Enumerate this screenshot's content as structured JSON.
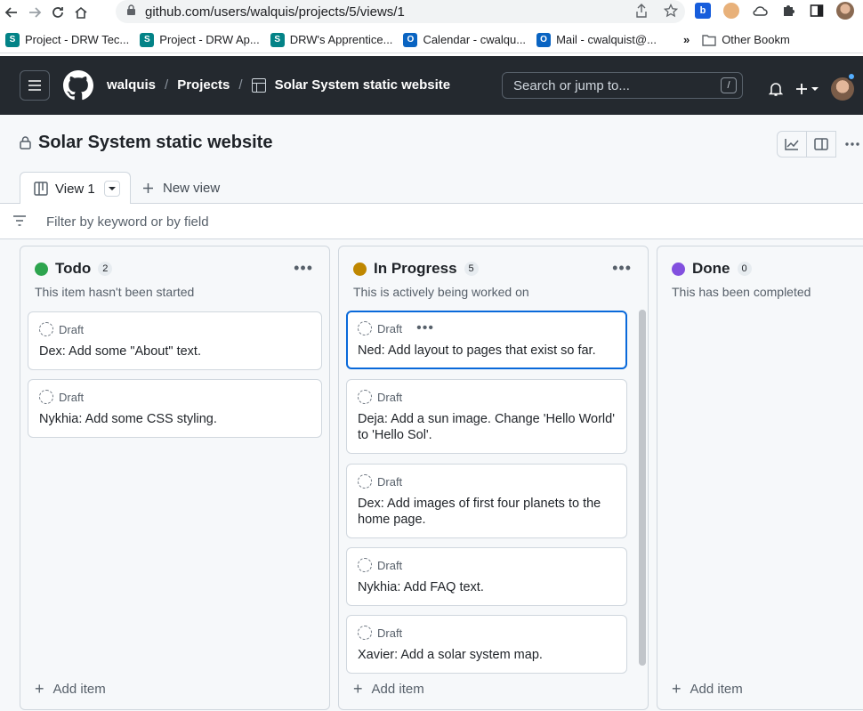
{
  "browser": {
    "url": "github.com/users/walquis/projects/5/views/1",
    "bookmarks": [
      {
        "label": "Project - DRW Tec...",
        "icon": "sharepoint-icon"
      },
      {
        "label": "Project - DRW Ap...",
        "icon": "sharepoint-icon"
      },
      {
        "label": "DRW's Apprentice...",
        "icon": "sharepoint-icon"
      },
      {
        "label": "Calendar - cwalqu...",
        "icon": "outlook-icon"
      },
      {
        "label": "Mail - cwalquist@...",
        "icon": "outlook-icon"
      }
    ],
    "more_bookmarks": "»",
    "other_bookmarks": "Other Bookm"
  },
  "header": {
    "user": "walquis",
    "projects": "Projects",
    "project_name": "Solar System static website",
    "search_placeholder": "Search or jump to...",
    "search_shortcut": "/"
  },
  "page": {
    "title": "Solar System static website"
  },
  "tabs": {
    "active": "View 1",
    "new_view": "New view"
  },
  "filter": {
    "placeholder": "Filter by keyword or by field"
  },
  "columns": [
    {
      "name": "Todo",
      "count": "2",
      "color": "#2da44e",
      "description": "This item hasn't been started",
      "cards": [
        {
          "draft": "Draft",
          "title": "Dex: Add some \"About\" text."
        },
        {
          "draft": "Draft",
          "title": "Nykhia: Add some CSS styling."
        }
      ],
      "add_item": "Add item"
    },
    {
      "name": "In Progress",
      "count": "5",
      "color": "#bf8700",
      "description": "This is actively being worked on",
      "cards": [
        {
          "draft": "Draft",
          "title": "Ned: Add layout to pages that exist so far."
        },
        {
          "draft": "Draft",
          "title": "Deja: Add a sun image. Change 'Hello World' to 'Hello Sol'."
        },
        {
          "draft": "Draft",
          "title": "Dex: Add images of first four planets to the home page."
        },
        {
          "draft": "Draft",
          "title": "Nykhia: Add FAQ text."
        },
        {
          "draft": "Draft",
          "title": "Xavier: Add a solar system map."
        }
      ],
      "add_item": "Add item"
    },
    {
      "name": "Done",
      "count": "0",
      "color": "#8250df",
      "description": "This has been completed",
      "cards": [],
      "add_item": "Add item"
    }
  ]
}
